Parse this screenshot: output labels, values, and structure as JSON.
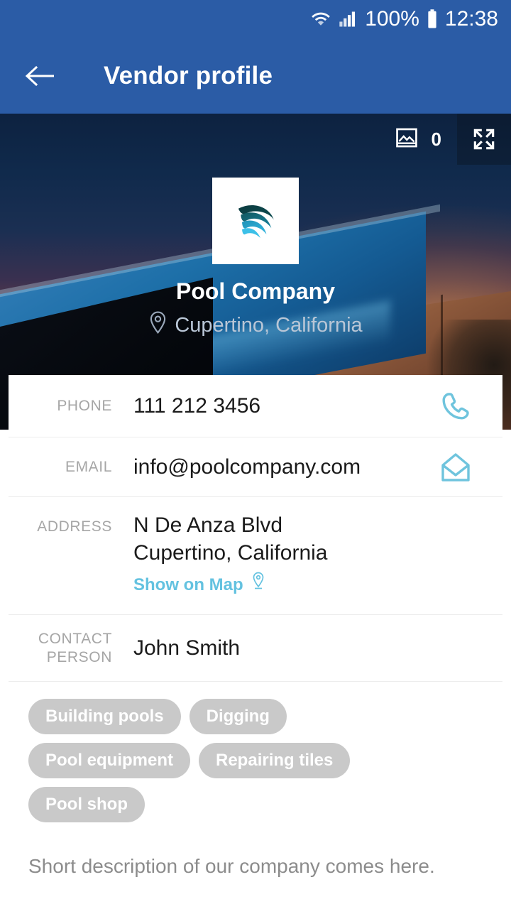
{
  "statusbar": {
    "wifi_icon": "wifi-icon",
    "signal_icon": "cellular-signal-icon",
    "battery_label": "100%",
    "battery_icon": "battery-full-icon",
    "time": "12:38"
  },
  "appbar": {
    "back_icon": "arrow-left-icon",
    "title": "Vendor profile",
    "background_color": "#2b5ca6"
  },
  "hero": {
    "photo_icon": "image-icon",
    "photo_count": "0",
    "fullscreen_icon": "fullscreen-expand-icon",
    "logo_icon": "company-logo-wave",
    "company_name": "Pool Company",
    "location_icon": "map-pin-icon",
    "location": "Cupertino, California"
  },
  "details": {
    "phone": {
      "label": "PHONE",
      "value": "111 212 3456",
      "action_icon": "phone-icon"
    },
    "email": {
      "label": "EMAIL",
      "value": "info@poolcompany.com",
      "action_icon": "envelope-icon"
    },
    "address": {
      "label": "ADDRESS",
      "line1": "N De Anza Blvd",
      "line2": "Cupertino, California",
      "map_link": "Show on Map",
      "map_icon": "map-pin-icon"
    },
    "contact_person": {
      "label_line1": "CONTACT",
      "label_line2": "PERSON",
      "value": "John Smith"
    }
  },
  "tags": [
    "Building pools",
    "Digging",
    "Pool equipment",
    "Repairing tiles",
    "Pool shop"
  ],
  "description": "Short description of our company comes here.",
  "colors": {
    "primary": "#2b5ca6",
    "accent": "#64c2e0",
    "chip": "#c9c9c9",
    "label": "#a6a6a6"
  }
}
